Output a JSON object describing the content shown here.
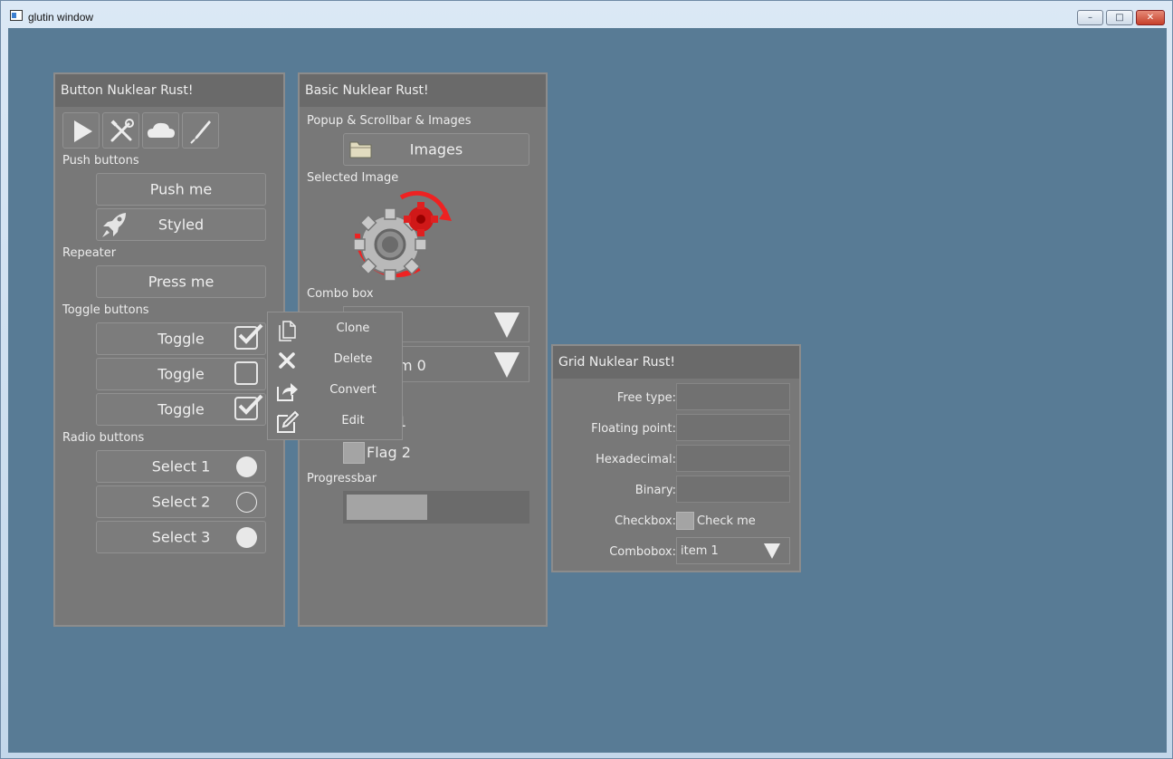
{
  "window": {
    "title": "glutin window",
    "minimize_glyph": "–",
    "maximize_glyph": "□",
    "close_glyph": "✕"
  },
  "button_panel": {
    "title": "Button Nuklear Rust!",
    "icon_buttons": [
      "play-icon",
      "tools-icon",
      "cloud-icon",
      "pen-icon"
    ],
    "push_label": "Push buttons",
    "push_me": "Push me",
    "styled": "Styled",
    "repeater_label": "Repeater",
    "press_me": "Press me",
    "toggle_label": "Toggle buttons",
    "toggles": [
      {
        "label": "Toggle",
        "checked": true
      },
      {
        "label": "Toggle",
        "checked": false
      },
      {
        "label": "Toggle",
        "checked": true
      }
    ],
    "radio_label": "Radio buttons",
    "radios": [
      {
        "label": "Select 1",
        "selected": true
      },
      {
        "label": "Select 2",
        "selected": false
      },
      {
        "label": "Select 3",
        "selected": true
      }
    ]
  },
  "basic_panel": {
    "title": "Basic Nuklear Rust!",
    "popup_label": "Popup & Scrollbar & Images",
    "images_button": "Images",
    "selected_label": "Selected Image",
    "combo_label": "Combo box",
    "combo_item_partial": "m 0",
    "flag_partial": "1",
    "flag2": "Flag 2",
    "progress_label": "Progressbar",
    "progress": 0.45
  },
  "context_menu": {
    "items": [
      {
        "label": "Clone",
        "icon": "copy-icon"
      },
      {
        "label": "Delete",
        "icon": "x-icon"
      },
      {
        "label": "Convert",
        "icon": "share-icon"
      },
      {
        "label": "Edit",
        "icon": "edit-icon"
      }
    ]
  },
  "grid_panel": {
    "title": "Grid Nuklear Rust!",
    "free_type": "Free type:",
    "floating_point": "Floating point:",
    "hexadecimal": "Hexadecimal:",
    "binary": "Binary:",
    "checkbox_label": "Checkbox:",
    "check_me": "Check me",
    "combobox_label": "Combobox:",
    "combobox_value": "item 1"
  },
  "colors": {
    "desktop": "#587b95",
    "panel": "#787878",
    "header": "#6a6a6a",
    "text": "#e8e8e8"
  }
}
